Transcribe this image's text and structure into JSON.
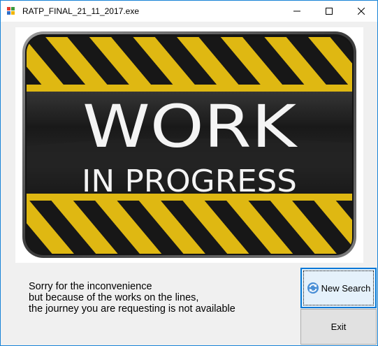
{
  "window": {
    "title": "RATP_FINAL_21_11_2017.exe",
    "controls": {
      "minimize": "minimize-icon",
      "maximize": "maximize-icon",
      "close": "close-icon"
    }
  },
  "banner": {
    "line1": "WORK",
    "line2": "IN PROGRESS"
  },
  "message": {
    "lines": [
      "Sorry for the inconvenience",
      "but because of the works on the lines,",
      "the journey you are requesting is not available"
    ]
  },
  "buttons": {
    "new_search": "New Search",
    "exit": "Exit"
  },
  "colors": {
    "stripe_yellow": "#f2c814",
    "stripe_black": "#1a1a1a",
    "accent": "#0078d7"
  }
}
